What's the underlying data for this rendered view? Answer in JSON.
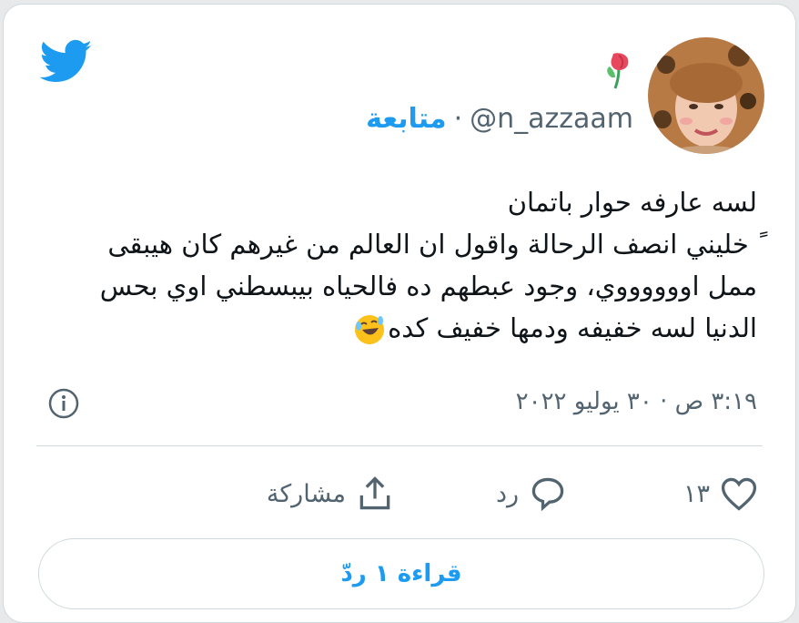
{
  "header": {
    "handle": "@n_azzaam",
    "separator": "·",
    "follow_label": "متابعة"
  },
  "tweet": {
    "lines": [
      "لسه عارفه حوار باتمان",
      "ً خليني انصف الرحالة واقول ان العالم من غيرهم كان هيبقى",
      "ممل اووووووي، وجود عبطهم ده فالحياه بيبسطني اوي بحس",
      "الدنيا لسه خفيفه ودمها خفيف كده"
    ],
    "timestamp": "٣:١٩ ص · ٣٠ يوليو ٢٠٢٢"
  },
  "actions": {
    "like_count": "١٣",
    "reply_label": "رد",
    "share_label": "مشاركة"
  },
  "footer": {
    "read_replies_label": "قراءة ١ ردّ"
  },
  "colors": {
    "accent": "#1d9bf0",
    "text": "#0f1419",
    "muted": "#536471",
    "border": "#cfd9de"
  },
  "icons": [
    "twitter-bird-icon",
    "tulip-emoji-icon",
    "laughing-emoji-icon",
    "info-icon",
    "heart-icon",
    "reply-bubble-icon",
    "share-icon"
  ]
}
